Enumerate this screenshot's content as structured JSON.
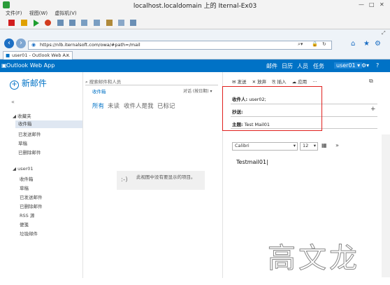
{
  "vm": {
    "title": "localhost.localdomain 上的 Iternal-Ex03",
    "menu": [
      "文件(F)",
      "视图(W)",
      "虚拟机(V)"
    ]
  },
  "browser": {
    "url": "https://nlb.iternalsoft.com/owa/#path=/mail",
    "tab_title": "user01 - Outlook Web A..."
  },
  "owa": {
    "brand": "Outlook Web App",
    "nav": [
      "邮件",
      "日历",
      "人员",
      "任务"
    ],
    "user": "user01",
    "new_mail": "新邮件",
    "search_placeholder": "搜索邮件和人员",
    "folder_title": "收件箱",
    "sort_label": "对话 (按日期)",
    "filters": [
      "所有",
      "未读",
      "收件人是我",
      "已标记"
    ],
    "empty_message": "此视图中没有要显示的项目。",
    "empty_icon": ":-)",
    "favorites_label": "收藏夹",
    "favorites": [
      "收件箱",
      "已发送邮件",
      "草稿",
      "已删除邮件"
    ],
    "mailbox_label": "user01",
    "mailbox_folders": [
      "收件箱",
      "草稿",
      "已发送邮件",
      "已删除邮件",
      "RSS 源",
      "便笺",
      "垃圾邮件"
    ]
  },
  "compose": {
    "actions": [
      "发送",
      "放弃",
      "插入",
      "应用"
    ],
    "to_label": "收件人:",
    "to_value": "user02;",
    "cc_label": "抄送:",
    "subject_label": "主题:",
    "subject_value": "Test Mail01",
    "font": "Calibri",
    "font_size": "12",
    "body": "Testmail01"
  },
  "watermark": "高文龙"
}
